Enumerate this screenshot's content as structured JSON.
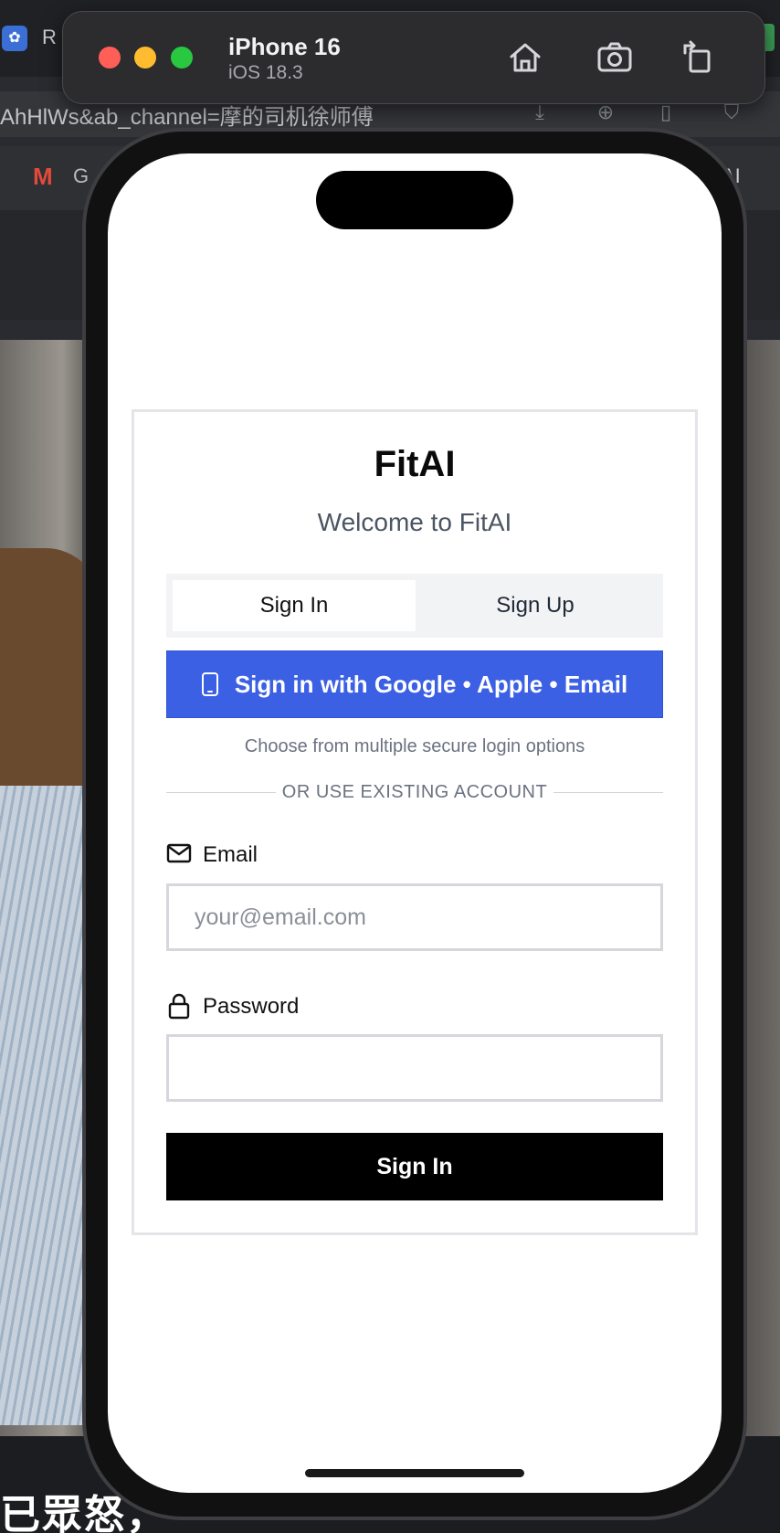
{
  "browser_background": {
    "tab_title": "R",
    "url_fragment": "AhHlWs&ab_channel=摩的司机徐师傅",
    "bookmark_gmail": "M",
    "bookmark_g": "G",
    "bookmark_ai": "AI",
    "video_caption": "已眾怒，"
  },
  "simulator": {
    "device_name": "iPhone 16",
    "os_version": "iOS 18.3",
    "toolbar_icons": [
      "home-icon",
      "screenshot-icon",
      "rotate-icon"
    ]
  },
  "app": {
    "title": "FitAI",
    "subtitle": "Welcome to FitAI",
    "tabs": [
      {
        "label": "Sign In",
        "active": true
      },
      {
        "label": "Sign Up",
        "active": false
      }
    ],
    "oauth_button_label": "Sign in with Google • Apple • Email",
    "oauth_hint": "Choose from multiple secure login options",
    "divider_text": "OR USE EXISTING ACCOUNT",
    "email": {
      "label": "Email",
      "placeholder": "your@email.com",
      "value": ""
    },
    "password": {
      "label": "Password",
      "placeholder": "",
      "value": ""
    },
    "submit_label": "Sign In",
    "colors": {
      "oauth_button": "#3b60e4",
      "submit_button": "#000000",
      "card_border": "#e3e5e8"
    }
  }
}
